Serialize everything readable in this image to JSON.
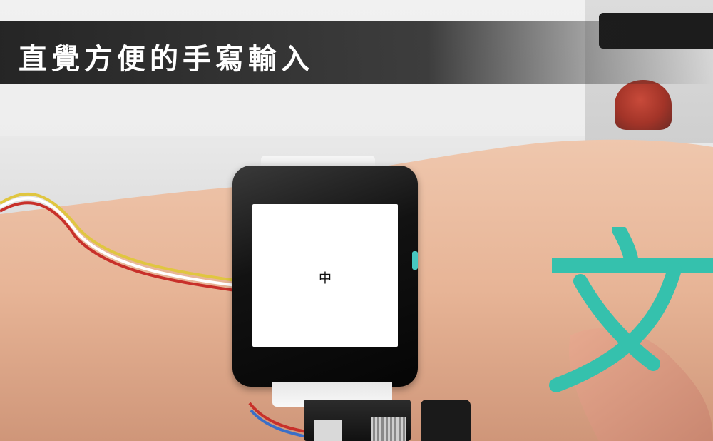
{
  "banner": {
    "title": "直覺方便的手寫輸入"
  },
  "watch": {
    "screen_character": "中"
  },
  "overlay": {
    "handwritten_glyph_name": "bopomofo-character",
    "glyph_color": "#35c1ad"
  },
  "colors": {
    "banner_bg": "#1e1e1e",
    "banner_text": "#ffffff",
    "skin": "#e8b79a",
    "wire_red": "#c8302a",
    "wire_yellow": "#e2c23a"
  }
}
